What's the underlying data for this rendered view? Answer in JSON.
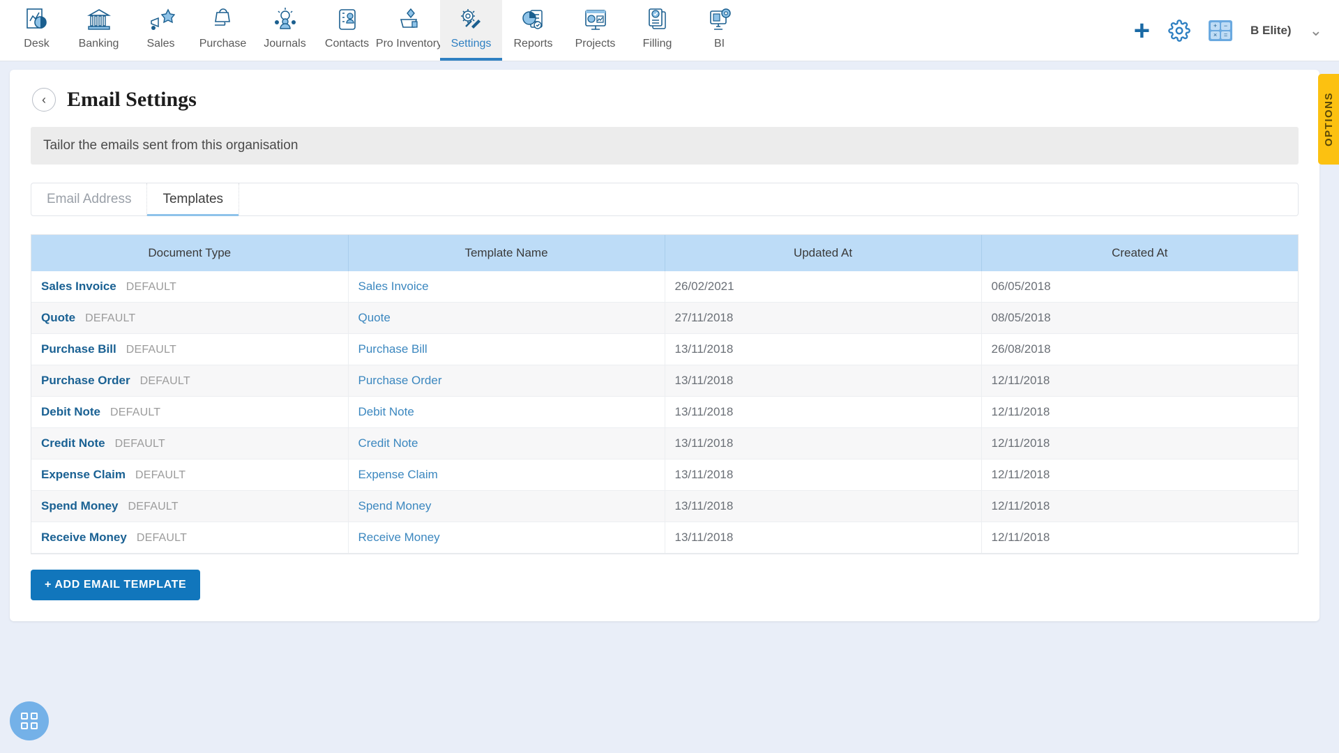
{
  "topnav": {
    "items": [
      {
        "label": "Desk",
        "icon": "desk-chart-icon",
        "active": false
      },
      {
        "label": "Banking",
        "icon": "bank-building-icon",
        "active": false
      },
      {
        "label": "Sales",
        "icon": "sales-megaphone-icon",
        "active": false
      },
      {
        "label": "Purchase",
        "icon": "purchase-bag-icon",
        "active": false
      },
      {
        "label": "Journals",
        "icon": "journals-people-icon",
        "active": false
      },
      {
        "label": "Contacts",
        "icon": "contacts-card-icon",
        "active": false
      },
      {
        "label": "Pro Inventory",
        "icon": "inventory-cart-icon",
        "active": false
      },
      {
        "label": "Settings",
        "icon": "settings-tools-icon",
        "active": true
      },
      {
        "label": "Reports",
        "icon": "reports-pie-icon",
        "active": false
      },
      {
        "label": "Projects",
        "icon": "projects-board-icon",
        "active": false
      },
      {
        "label": "Filling",
        "icon": "filling-docs-icon",
        "active": false
      },
      {
        "label": "BI",
        "icon": "bi-monitor-icon",
        "active": false
      }
    ],
    "add_icon": "plus-icon",
    "settings_icon": "gear-icon",
    "calculator_icon": "calculator-icon",
    "calculator_glyphs": [
      "+",
      "−",
      "×",
      "="
    ],
    "user_name": "B Elite)",
    "dropdown_icon": "chevron-down-icon"
  },
  "page": {
    "back_icon": "chevron-left-icon",
    "title": "Email Settings",
    "banner": "Tailor the emails sent from this organisation"
  },
  "tabs": [
    {
      "label": "Email Address",
      "active": false
    },
    {
      "label": "Templates",
      "active": true
    }
  ],
  "table": {
    "columns": [
      "Document Type",
      "Template Name",
      "Updated At",
      "Created At"
    ],
    "default_badge": "DEFAULT",
    "rows": [
      {
        "doc_type": "Sales Invoice",
        "badge": "DEFAULT",
        "template_name": "Sales Invoice",
        "updated_at": "26/02/2021",
        "created_at": "06/05/2018"
      },
      {
        "doc_type": "Quote",
        "badge": "DEFAULT",
        "template_name": "Quote",
        "updated_at": "27/11/2018",
        "created_at": "08/05/2018"
      },
      {
        "doc_type": "Purchase Bill",
        "badge": "DEFAULT",
        "template_name": "Purchase Bill",
        "updated_at": "13/11/2018",
        "created_at": "26/08/2018"
      },
      {
        "doc_type": "Purchase Order",
        "badge": "DEFAULT",
        "template_name": "Purchase Order",
        "updated_at": "13/11/2018",
        "created_at": "12/11/2018"
      },
      {
        "doc_type": "Debit Note",
        "badge": "DEFAULT",
        "template_name": "Debit Note",
        "updated_at": "13/11/2018",
        "created_at": "12/11/2018"
      },
      {
        "doc_type": "Credit Note",
        "badge": "DEFAULT",
        "template_name": "Credit Note",
        "updated_at": "13/11/2018",
        "created_at": "12/11/2018"
      },
      {
        "doc_type": "Expense Claim",
        "badge": "DEFAULT",
        "template_name": "Expense Claim",
        "updated_at": "13/11/2018",
        "created_at": "12/11/2018"
      },
      {
        "doc_type": "Spend Money",
        "badge": "DEFAULT",
        "template_name": "Spend Money",
        "updated_at": "13/11/2018",
        "created_at": "12/11/2018"
      },
      {
        "doc_type": "Receive Money",
        "badge": "DEFAULT",
        "template_name": "Receive Money",
        "updated_at": "13/11/2018",
        "created_at": "12/11/2018"
      }
    ]
  },
  "add_button": {
    "label": "+ ADD EMAIL TEMPLATE"
  },
  "options_tab": {
    "label": "OPTIONS"
  },
  "fab": {
    "icon": "grid-apps-icon"
  },
  "colors": {
    "page_background": "#e9eef8",
    "accent_blue": "#1176bc",
    "table_header": "#bddcf7",
    "doc_type_link": "#1a6193",
    "template_link": "#3b87bf",
    "options_yellow": "#fcc111",
    "fab_blue": "#74b1e8",
    "banner_gray": "#ececec"
  }
}
